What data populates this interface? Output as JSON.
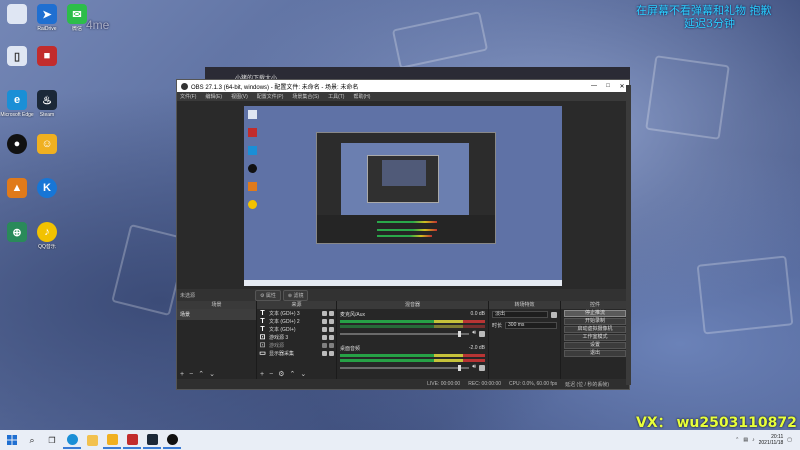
{
  "desktop": {
    "icons": [
      {
        "label": "",
        "color": "#dfe6f3",
        "glyph": "▯"
      },
      {
        "label": "RaiDrive",
        "color": "#1f6fd1",
        "glyph": "➤"
      },
      {
        "label": "微信",
        "color": "#2dbd4a",
        "glyph": "✉"
      },
      {
        "label": "",
        "color": "#dfe6f3",
        "glyph": "▯"
      },
      {
        "label": "",
        "color": "#c22c2c",
        "glyph": "■"
      },
      {
        "label": "Microsoft Edge",
        "color": "#1a8fd6",
        "glyph": "e"
      },
      {
        "label": "Steam",
        "color": "#1b2838",
        "glyph": "♨"
      },
      {
        "label": "",
        "color": "#111111",
        "glyph": "●"
      },
      {
        "label": "",
        "color": "#f0b020",
        "glyph": "☺"
      },
      {
        "label": "",
        "color": "#e07a1a",
        "glyph": "▲"
      },
      {
        "label": "",
        "color": "#1776d6",
        "glyph": "K"
      },
      {
        "label": "",
        "color": "#2a8a5a",
        "glyph": "⊕"
      },
      {
        "label": "QQ音乐",
        "color": "#f2c200",
        "glyph": "♪"
      }
    ],
    "faint_text": "4me",
    "overlay_top_right_line1": "在屏幕不看弹幕和礼物 抱歉",
    "overlay_top_right_line2": "延迟3分钟",
    "watermark": "VX： wu2503110872"
  },
  "back_window": {
    "title": "小猪的下载大小"
  },
  "obs": {
    "title": "OBS 27.1.3 (64-bit, windows) - 配置文件: 未命名 - 场景: 未命名",
    "menus": [
      "文件(F)",
      "编辑(E)",
      "视图(V)",
      "配置文件(P)",
      "场景集合(S)",
      "工具(T)",
      "帮助(H)"
    ],
    "scenebar": {
      "label": "未选源",
      "props_btn": "⚙ 属性",
      "filters_btn": "⊛ 滤镜"
    },
    "docks": {
      "scenes_header": "场景",
      "sources_header": "来源",
      "mixer_header": "混音器",
      "transitions_header": "转场特效",
      "controls_header": "控件"
    },
    "scenes": [
      "场景"
    ],
    "sources": [
      {
        "icon": "T",
        "name": "文本 (GDI+) 3"
      },
      {
        "icon": "T",
        "name": "文本 (GDI+) 2"
      },
      {
        "icon": "T",
        "name": "文本 (GDI+)"
      },
      {
        "icon": "⊡",
        "name": "游戏源 3"
      },
      {
        "icon": "⊡",
        "name": "游戏源"
      },
      {
        "icon": "▭",
        "name": "显示器采集"
      }
    ],
    "mixer": [
      {
        "name": "桌面音频",
        "level": "-2.0 dB"
      },
      {
        "name": "麦克风/Aux",
        "level": "0.0 dB"
      }
    ],
    "transition": {
      "type": "淡出",
      "duration_label": "时长",
      "duration": "300 ms"
    },
    "controls": [
      "停止推流",
      "开始录制",
      "启动虚拟摄像机",
      "工作室模式",
      "设置",
      "退出"
    ],
    "status": {
      "live": "LIVE: 00:00:00",
      "rec": "REC: 00:00:00",
      "cpu": "CPU: 0.0%, 60.00 fps",
      "kbps": "延迟 (位 / 秒的丢帧)"
    }
  },
  "taskbar": {
    "time": "20:11",
    "date": "2021/11/18"
  }
}
